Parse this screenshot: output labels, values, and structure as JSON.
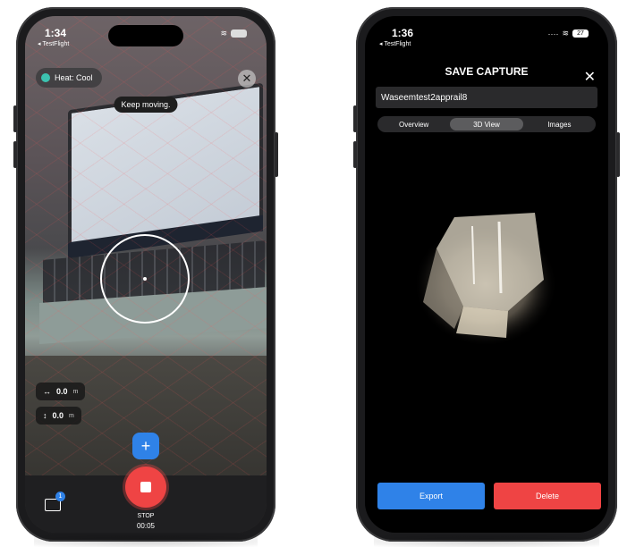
{
  "left_phone": {
    "status_time": "1:34",
    "back_app": "◂ TestFlight",
    "heat_label": "Heat: Cool",
    "close_icon": "close-icon",
    "toast": "Keep moving.",
    "measure_width": {
      "value": "0.0",
      "unit": "m",
      "icon": "↔"
    },
    "measure_height": {
      "value": "0.0",
      "unit": "m",
      "icon": "↕"
    },
    "add_label": "+",
    "stop_label": "STOP",
    "timer": "00:05",
    "folder_badge": "1"
  },
  "right_phone": {
    "status_time": "1:36",
    "back_app": "◂ TestFlight",
    "battery": "27",
    "title": "SAVE CAPTURE",
    "capture_name": "Waseemtest2apprail8",
    "tabs": [
      {
        "label": "Overview",
        "active": false
      },
      {
        "label": "3D View",
        "active": true
      },
      {
        "label": "Images",
        "active": false
      }
    ],
    "export_label": "Export",
    "delete_label": "Delete"
  },
  "colors": {
    "accent_blue": "#2f82e8",
    "record_red": "#ef4444",
    "heat_cool": "#3cc3b0"
  }
}
